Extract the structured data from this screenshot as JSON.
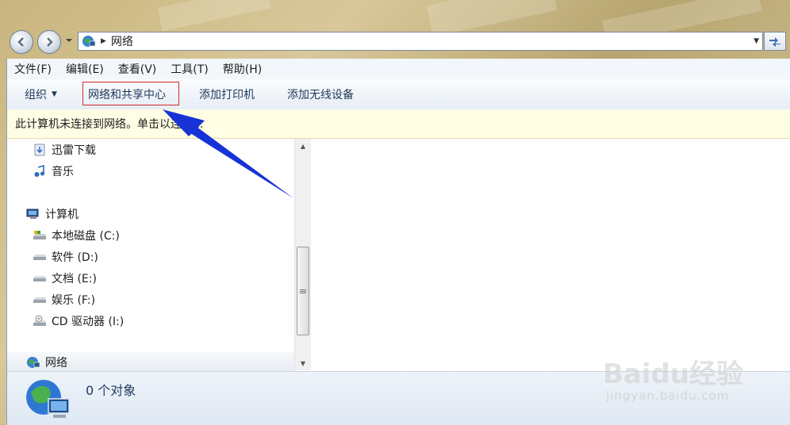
{
  "address_bar": {
    "path": "网络"
  },
  "menu": [
    "文件(F)",
    "编辑(E)",
    "查看(V)",
    "工具(T)",
    "帮助(H)"
  ],
  "toolbar": {
    "organize": "组织",
    "network_center": "网络和共享中心",
    "add_printer": "添加打印机",
    "add_wireless": "添加无线设备"
  },
  "infobar": {
    "message": "此计算机未连接到网络。单击以连接..."
  },
  "nav": {
    "downloads": "迅雷下载",
    "music": "音乐",
    "computer": "计算机",
    "drive_c": "本地磁盘 (C:)",
    "drive_d": "软件 (D:)",
    "drive_e": "文档 (E:)",
    "drive_f": "娱乐 (F:)",
    "drive_i": "CD 驱动器 (I:)",
    "network": "网络"
  },
  "status": {
    "count": "0 个对象"
  },
  "watermark": {
    "brand": "Baidu经验",
    "url": "jingyan.baidu.com"
  },
  "colors": {
    "accent_arrow": "#1733d6",
    "highlight_box": "#d22b2b",
    "infobar": "#fffde3"
  }
}
